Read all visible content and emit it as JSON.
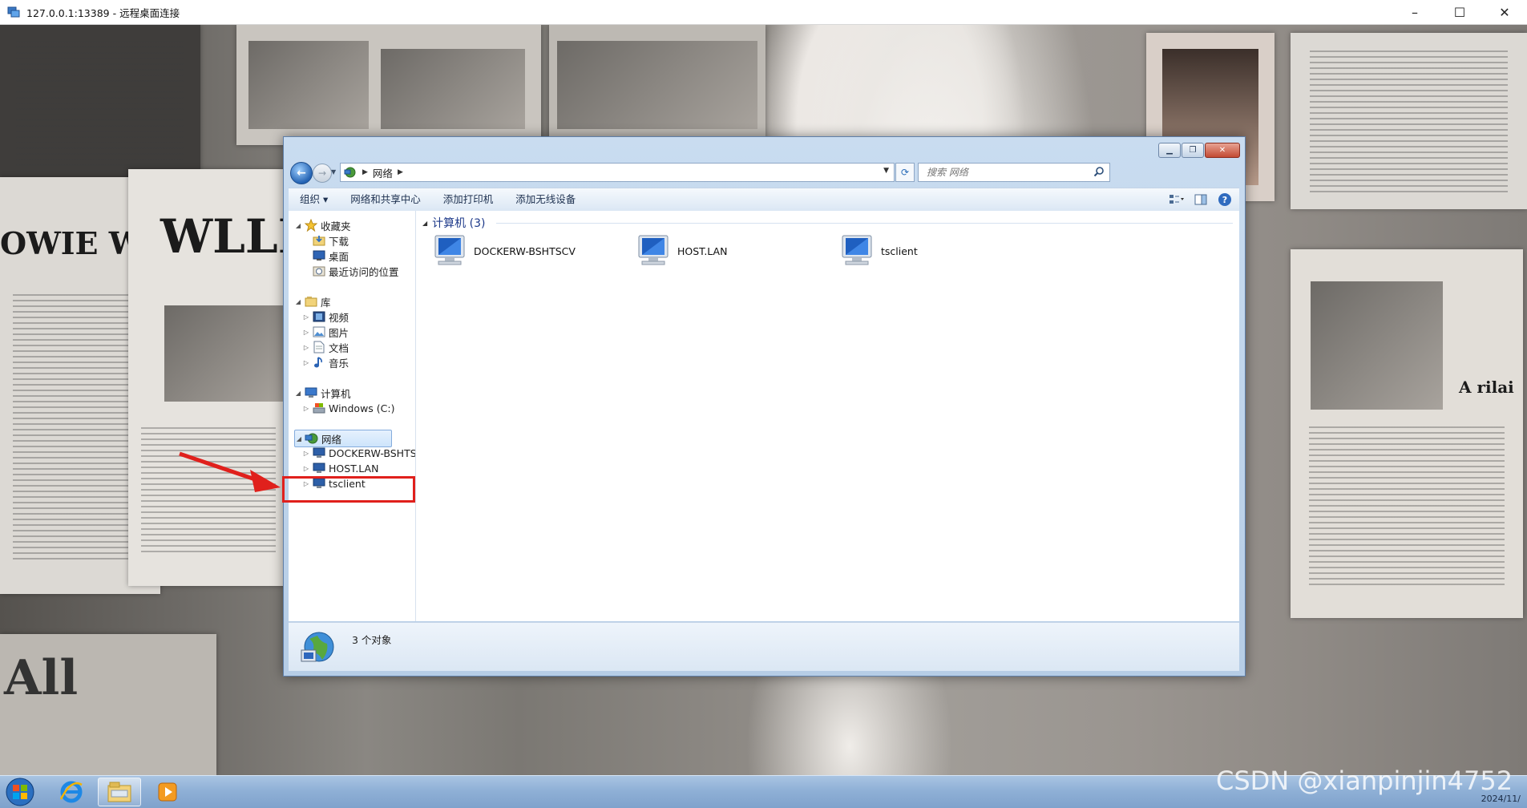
{
  "rdp": {
    "title": "127.0.0.1:13389 - 远程桌面连接",
    "minimize": "–",
    "maximize": "☐",
    "close": "✕"
  },
  "explorer": {
    "address": {
      "crumb": "网络"
    },
    "search_placeholder": "搜索 网络",
    "toolbar": {
      "organize": "组织 ▾",
      "network_center": "网络和共享中心",
      "add_printer": "添加打印机",
      "add_wireless": "添加无线设备"
    },
    "nav": {
      "favorites": "收藏夹",
      "downloads": "下载",
      "desktop": "桌面",
      "recent": "最近访问的位置",
      "libraries": "库",
      "videos": "视频",
      "pictures": "图片",
      "documents": "文档",
      "music": "音乐",
      "computer": "计算机",
      "drive_c": "Windows (C:)",
      "network": "网络",
      "net_items": [
        "DOCKERW-BSHTS",
        "HOST.LAN",
        "tsclient"
      ]
    },
    "group_title": "计算机 (3)",
    "items": [
      "DOCKERW-BSHTSCV",
      "HOST.LAN",
      "tsclient"
    ],
    "status_count": "3 个对象"
  },
  "taskbar": {
    "date": "2024/11/"
  },
  "watermark": "CSDN @xianpinjin4752"
}
